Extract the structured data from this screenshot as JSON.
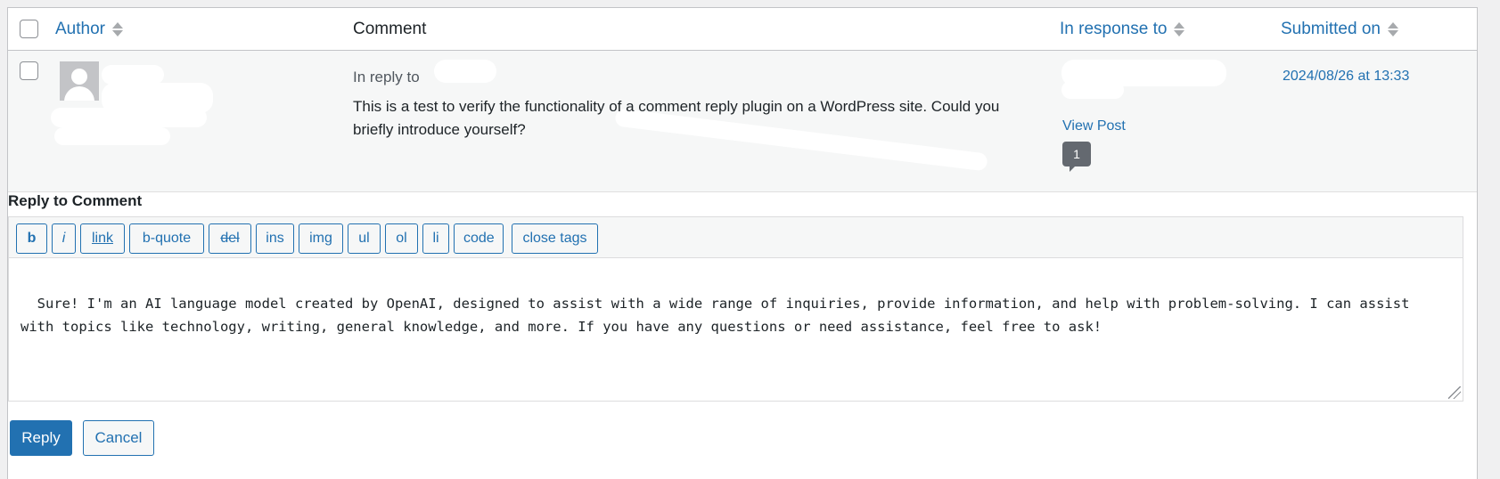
{
  "header": {
    "author_label": "Author",
    "comment_label": "Comment",
    "response_label": "In response to",
    "submitted_label": "Submitted on"
  },
  "comment": {
    "reply_prefix": "In reply to",
    "text": "This is a test to verify the functionality of a comment reply plugin on a WordPress site. Could you briefly introduce yourself?",
    "view_post_label": "View Post",
    "comment_count": "1",
    "submitted_on": "2024/08/26 at 13:33"
  },
  "reply": {
    "title": "Reply to Comment",
    "toolbar": [
      "b",
      "i",
      "link",
      "b-quote",
      "del",
      "ins",
      "img",
      "ul",
      "ol",
      "li",
      "code",
      "close tags"
    ],
    "text": "Sure! I'm an AI language model created by OpenAI, designed to assist with a wide range of inquiries, provide information, and help with problem-solving. I can assist with topics like technology, writing, general knowledge, and more. If you have any questions or need assistance, feel free to ask!",
    "reply_button": "Reply",
    "cancel_button": "Cancel"
  },
  "colors": {
    "accent": "#2271b1",
    "row_bg": "#f6f7f7",
    "bubble": "#646970"
  }
}
